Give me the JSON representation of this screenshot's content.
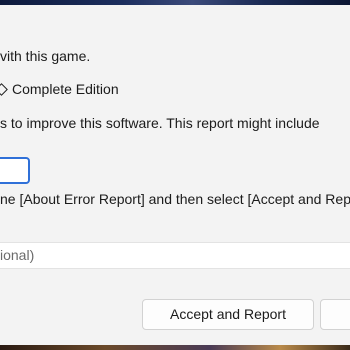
{
  "dialog": {
    "line1": "vith this game.",
    "line2_text": "Complete Edition",
    "line3": "s to improve this software. This report might include",
    "line4": "ne [About Error Report] and then select [Accept and Report].",
    "comment_placeholder": "ional)",
    "accept_button": "Accept and Report"
  }
}
